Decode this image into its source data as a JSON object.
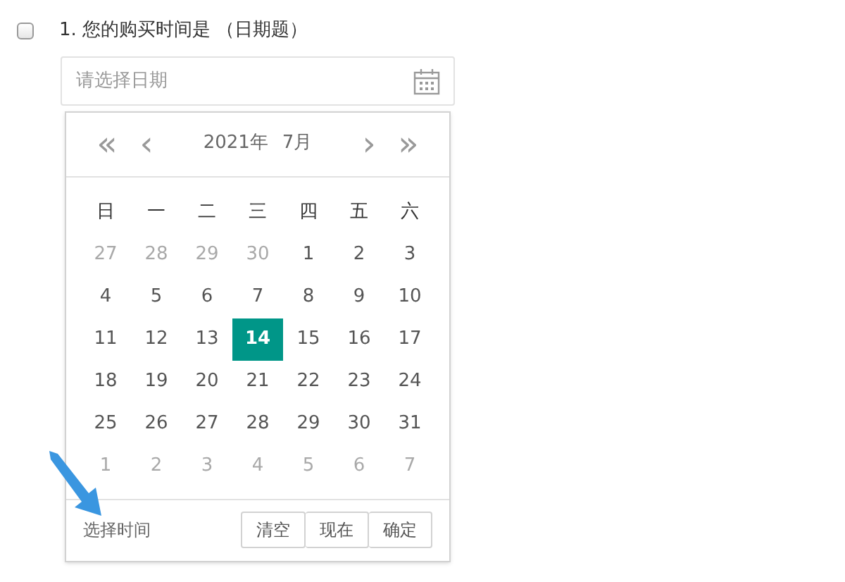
{
  "question": {
    "checked": false,
    "title": "1. 您的购买时间是 （日期题）"
  },
  "date_field": {
    "placeholder": "请选择日期"
  },
  "calendar": {
    "prev_year": "«",
    "prev_month": "‹",
    "year": "2021年",
    "month": "7月",
    "next_month": "›",
    "next_year": "»",
    "weekdays": [
      "日",
      "一",
      "二",
      "三",
      "四",
      "五",
      "六"
    ],
    "weeks": [
      [
        {
          "label": "27",
          "outside": true,
          "selected": false
        },
        {
          "label": "28",
          "outside": true,
          "selected": false
        },
        {
          "label": "29",
          "outside": true,
          "selected": false
        },
        {
          "label": "30",
          "outside": true,
          "selected": false
        },
        {
          "label": "1",
          "outside": false,
          "selected": false
        },
        {
          "label": "2",
          "outside": false,
          "selected": false
        },
        {
          "label": "3",
          "outside": false,
          "selected": false
        }
      ],
      [
        {
          "label": "4",
          "outside": false,
          "selected": false
        },
        {
          "label": "5",
          "outside": false,
          "selected": false
        },
        {
          "label": "6",
          "outside": false,
          "selected": false
        },
        {
          "label": "7",
          "outside": false,
          "selected": false
        },
        {
          "label": "8",
          "outside": false,
          "selected": false
        },
        {
          "label": "9",
          "outside": false,
          "selected": false
        },
        {
          "label": "10",
          "outside": false,
          "selected": false
        }
      ],
      [
        {
          "label": "11",
          "outside": false,
          "selected": false
        },
        {
          "label": "12",
          "outside": false,
          "selected": false
        },
        {
          "label": "13",
          "outside": false,
          "selected": false
        },
        {
          "label": "14",
          "outside": false,
          "selected": true
        },
        {
          "label": "15",
          "outside": false,
          "selected": false
        },
        {
          "label": "16",
          "outside": false,
          "selected": false
        },
        {
          "label": "17",
          "outside": false,
          "selected": false
        }
      ],
      [
        {
          "label": "18",
          "outside": false,
          "selected": false
        },
        {
          "label": "19",
          "outside": false,
          "selected": false
        },
        {
          "label": "20",
          "outside": false,
          "selected": false
        },
        {
          "label": "21",
          "outside": false,
          "selected": false
        },
        {
          "label": "22",
          "outside": false,
          "selected": false
        },
        {
          "label": "23",
          "outside": false,
          "selected": false
        },
        {
          "label": "24",
          "outside": false,
          "selected": false
        }
      ],
      [
        {
          "label": "25",
          "outside": false,
          "selected": false
        },
        {
          "label": "26",
          "outside": false,
          "selected": false
        },
        {
          "label": "27",
          "outside": false,
          "selected": false
        },
        {
          "label": "28",
          "outside": false,
          "selected": false
        },
        {
          "label": "29",
          "outside": false,
          "selected": false
        },
        {
          "label": "30",
          "outside": false,
          "selected": false
        },
        {
          "label": "31",
          "outside": false,
          "selected": false
        }
      ],
      [
        {
          "label": "1",
          "outside": true,
          "selected": false
        },
        {
          "label": "2",
          "outside": true,
          "selected": false
        },
        {
          "label": "3",
          "outside": true,
          "selected": false
        },
        {
          "label": "4",
          "outside": true,
          "selected": false
        },
        {
          "label": "5",
          "outside": true,
          "selected": false
        },
        {
          "label": "6",
          "outside": true,
          "selected": false
        },
        {
          "label": "7",
          "outside": true,
          "selected": false
        }
      ]
    ],
    "time_link": "选择时间",
    "buttons": [
      "清空",
      "现在",
      "确定"
    ]
  }
}
